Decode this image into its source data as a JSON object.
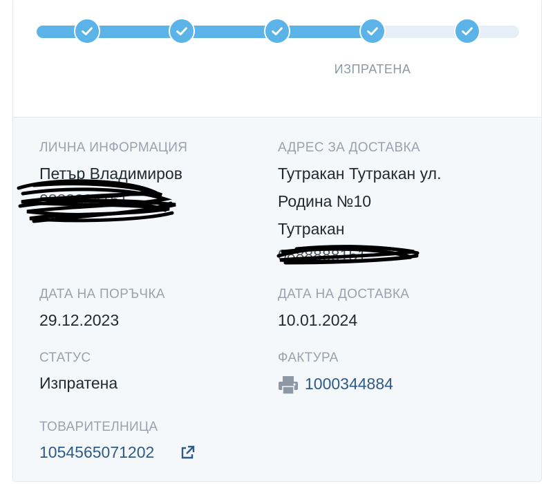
{
  "progress": {
    "steps_total": 5,
    "completed_fraction": 0.7,
    "current_step_label": "ИЗПРАТЕНА",
    "accent_color": "#5cb3e8"
  },
  "personal": {
    "label": "ЛИЧНА ИНФОРМАЦИЯ",
    "name": "Петър Владимиров",
    "phone_redacted": "0888888151"
  },
  "delivery_address": {
    "label": "АДРЕС ЗА ДОСТАВКА",
    "line1": "Тутракан Тутракан ул.",
    "line2": "Родина №10",
    "line3": "Тутракан",
    "phone_redacted": "0888888151"
  },
  "order_date": {
    "label": "ДАТА НА ПОРЪЧКА",
    "value": "29.12.2023"
  },
  "delivery_date": {
    "label": "ДАТА НА ДОСТАВКА",
    "value": "10.01.2024"
  },
  "status": {
    "label": "СТАТУС",
    "value": "Изпратена"
  },
  "invoice": {
    "label": "ФАКТУРА",
    "number": "1000344884",
    "icon": "printer-icon"
  },
  "waybill": {
    "label": "ТОВАРИТЕЛНИЦА",
    "number": "1054565071202",
    "icon": "external-link-icon"
  }
}
